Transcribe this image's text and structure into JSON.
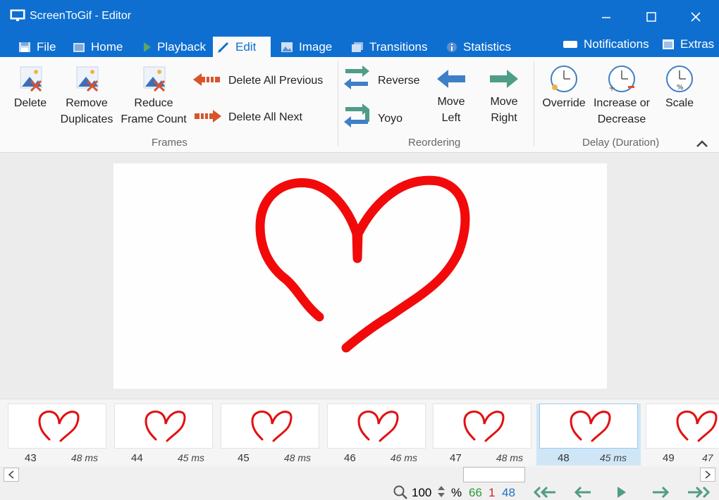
{
  "window": {
    "title": "ScreenToGif - Editor",
    "accent_color": "#0f6fd0"
  },
  "tabs": [
    {
      "label": "File",
      "icon": "floppy-icon"
    },
    {
      "label": "Home",
      "icon": "home-icon"
    },
    {
      "label": "Playback",
      "icon": "play-icon"
    },
    {
      "label": "Edit",
      "icon": "pencil-icon",
      "active": true
    },
    {
      "label": "Image",
      "icon": "image-icon"
    },
    {
      "label": "Transitions",
      "icon": "transitions-icon"
    },
    {
      "label": "Statistics",
      "icon": "info-icon"
    }
  ],
  "right_tabs": {
    "notifications": "Notifications",
    "extras": "Extras"
  },
  "ribbon": {
    "frames": {
      "delete": "Delete",
      "remove_line1": "Remove",
      "remove_line2": "Duplicates",
      "reduce_line1": "Reduce",
      "reduce_line2": "Frame Count",
      "delete_previous": "Delete All Previous",
      "delete_next": "Delete All Next",
      "group_label": "Frames"
    },
    "reordering": {
      "reverse": "Reverse",
      "yoyo": "Yoyo",
      "move_left_line1": "Move",
      "move_left_line2": "Left",
      "move_right_line1": "Move",
      "move_right_line2": "Right",
      "group_label": "Reordering"
    },
    "delay": {
      "override": "Override",
      "increase_line1": "Increase or",
      "increase_line2": "Decrease",
      "scale": "Scale",
      "group_label": "Delay (Duration)"
    }
  },
  "frames": [
    {
      "number": "43",
      "delay": "48 ms"
    },
    {
      "number": "44",
      "delay": "45 ms"
    },
    {
      "number": "45",
      "delay": "48 ms"
    },
    {
      "number": "46",
      "delay": "46 ms"
    },
    {
      "number": "47",
      "delay": "48 ms"
    },
    {
      "number": "48",
      "delay": "45 ms",
      "selected": true
    },
    {
      "number": "49",
      "delay": "47"
    }
  ],
  "status": {
    "zoom": "100",
    "zoom_unit": "%",
    "frame_count": "66",
    "selected_count": "1",
    "current_frame": "48",
    "colors": {
      "count": "#2f9a36",
      "selected": "#c62828",
      "current": "#1e6fc2"
    }
  }
}
